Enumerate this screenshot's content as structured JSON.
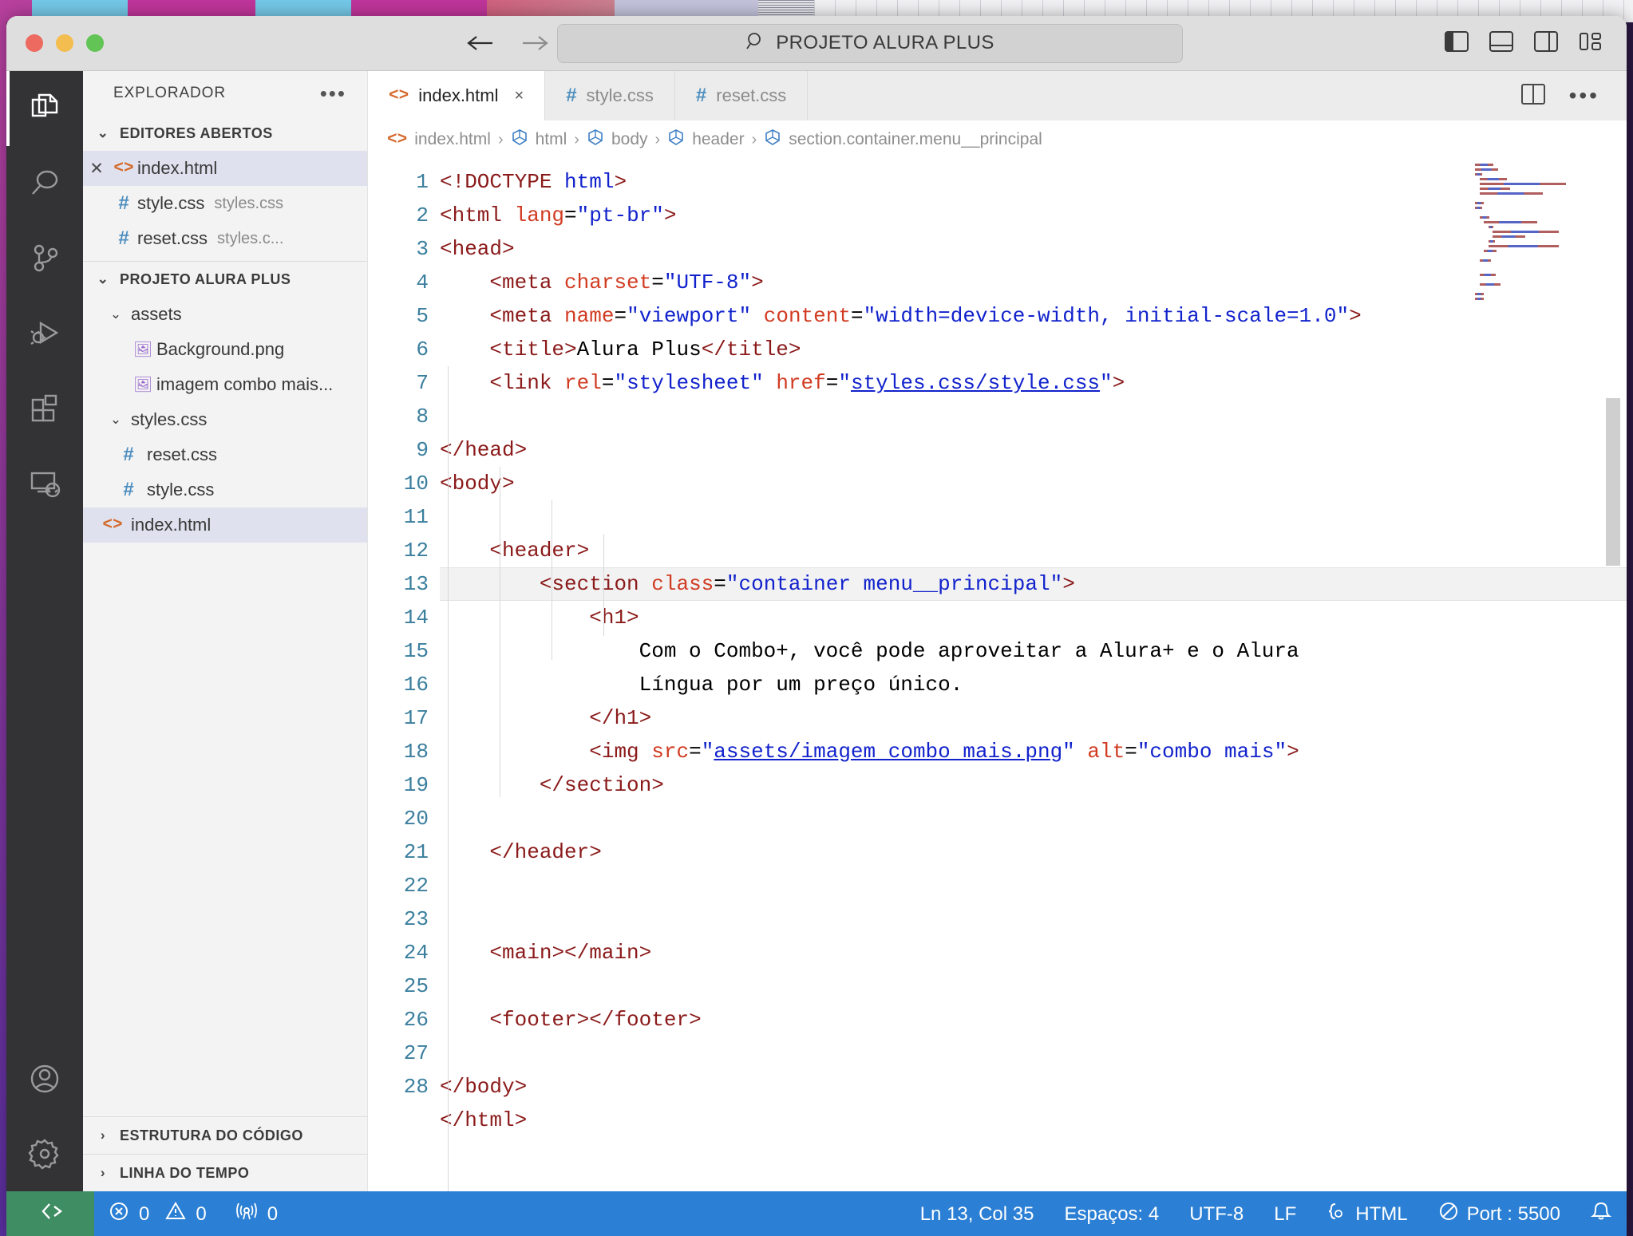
{
  "window": {
    "traffic": [
      "close",
      "minimize",
      "zoom"
    ],
    "search_title": "PROJETO ALURA PLUS",
    "nav_back": "back-arrow",
    "nav_forward": "forward-arrow",
    "layout_icons": [
      "toggle-primary-sidebar",
      "toggle-panel",
      "toggle-secondary-sidebar",
      "customize-layout"
    ]
  },
  "activity_bar": {
    "items": [
      {
        "name": "explorer",
        "active": true
      },
      {
        "name": "search",
        "active": false
      },
      {
        "name": "source-control",
        "active": false
      },
      {
        "name": "run-and-debug",
        "active": false
      },
      {
        "name": "extensions",
        "active": false
      },
      {
        "name": "remote-explorer",
        "active": false
      }
    ],
    "bottom": [
      {
        "name": "accounts"
      },
      {
        "name": "manage-settings"
      }
    ]
  },
  "explorer": {
    "title": "EXPLORADOR",
    "more_actions": "•••",
    "open_editors": {
      "label": "EDITORES ABERTOS",
      "expanded": true,
      "items": [
        {
          "name": "index.html",
          "detail": "",
          "icon": "html-icon",
          "selected": true,
          "closable": true
        },
        {
          "name": "style.css",
          "detail": "styles.css",
          "icon": "css-icon",
          "selected": false,
          "closable": false
        },
        {
          "name": "reset.css",
          "detail": "styles.c...",
          "icon": "css-icon",
          "selected": false,
          "closable": false
        }
      ]
    },
    "project": {
      "label": "PROJETO ALURA PLUS",
      "expanded": true,
      "items": [
        {
          "name": "assets",
          "type": "folder",
          "indent": 1,
          "expanded": true
        },
        {
          "name": "Background.png",
          "type": "image",
          "indent": 2
        },
        {
          "name": "imagem combo mais...",
          "type": "image",
          "indent": 2
        },
        {
          "name": "styles.css",
          "type": "folder",
          "indent": 1,
          "expanded": true
        },
        {
          "name": "reset.css",
          "type": "css",
          "indent": 2
        },
        {
          "name": "style.css",
          "type": "css",
          "indent": 2
        },
        {
          "name": "index.html",
          "type": "html",
          "indent": 1,
          "selected": true
        }
      ]
    },
    "outline": "ESTRUTURA DO CÓDIGO",
    "timeline": "LINHA DO TEMPO"
  },
  "tabs": [
    {
      "label": "index.html",
      "icon": "html-icon",
      "active": true,
      "close": "×"
    },
    {
      "label": "style.css",
      "icon": "css-icon",
      "active": false
    },
    {
      "label": "reset.css",
      "icon": "css-icon",
      "active": false
    }
  ],
  "tab_actions": [
    "split-editor-icon",
    "more-actions-icon"
  ],
  "breadcrumb": [
    {
      "label": "index.html",
      "icon": "html-icon"
    },
    {
      "label": "html",
      "icon": "symbol-icon"
    },
    {
      "label": "body",
      "icon": "symbol-icon"
    },
    {
      "label": "header",
      "icon": "symbol-icon"
    },
    {
      "label": "section.container.menu__principal",
      "icon": "symbol-icon"
    }
  ],
  "editor": {
    "current_line": 13,
    "total_lines": 28,
    "line_numbers": [
      1,
      2,
      3,
      4,
      5,
      6,
      7,
      8,
      9,
      10,
      11,
      12,
      13,
      14,
      15,
      16,
      17,
      18,
      19,
      20,
      21,
      22,
      23,
      24,
      25,
      26,
      27,
      28
    ],
    "code_lines": [
      "<!DOCTYPE html>",
      "<html lang=\"pt-br\">",
      "<head>",
      "    <meta charset=\"UTF-8\">",
      "    <meta name=\"viewport\" content=\"width=device-width, initial-scale=1.0\">",
      "    <title>Alura Plus</title>",
      "    <link rel=\"stylesheet\" href=\"styles.css/style.css\">",
      "",
      "</head>",
      "<body>",
      "",
      "    <header>",
      "        <section class=\"container menu__principal\">",
      "            <h1>",
      "                Com o Combo+, você pode aproveitar a Alura+ e o Alura",
      "                Língua por um preço único.",
      "            </h1>",
      "            <img src=\"assets/imagem combo mais.png\" alt=\"combo mais\">",
      "        </section>",
      "",
      "    </header>",
      "",
      "",
      "    <main></main>",
      "",
      "    <footer></footer>",
      "",
      "</body>",
      "</html>"
    ]
  },
  "status_bar": {
    "remote_icon": "remote-window-icon",
    "problems": {
      "errors_icon": "error-icon",
      "errors": "0",
      "warnings_icon": "warning-icon",
      "warnings": "0"
    },
    "ports": {
      "icon": "radio-tower-icon",
      "count": "0"
    },
    "cursor": "Ln 13, Col 35",
    "indentation": "Espaços: 4",
    "encoding": "UTF-8",
    "eol": "LF",
    "language": "HTML",
    "language_icon": "braces-icon",
    "live_server": "Port : 5500",
    "live_server_icon": "broadcast-icon",
    "notifications_icon": "bell-icon"
  },
  "colors": {
    "accent_status": "#2b7fd4",
    "remote_green": "#3f8d63",
    "tag": "#8b1a1a",
    "attribute": "#d13b22",
    "value": "#1122cc",
    "linenum": "#3b7f9e",
    "html_icon": "#d4692b",
    "css_icon": "#4f8fc0"
  }
}
